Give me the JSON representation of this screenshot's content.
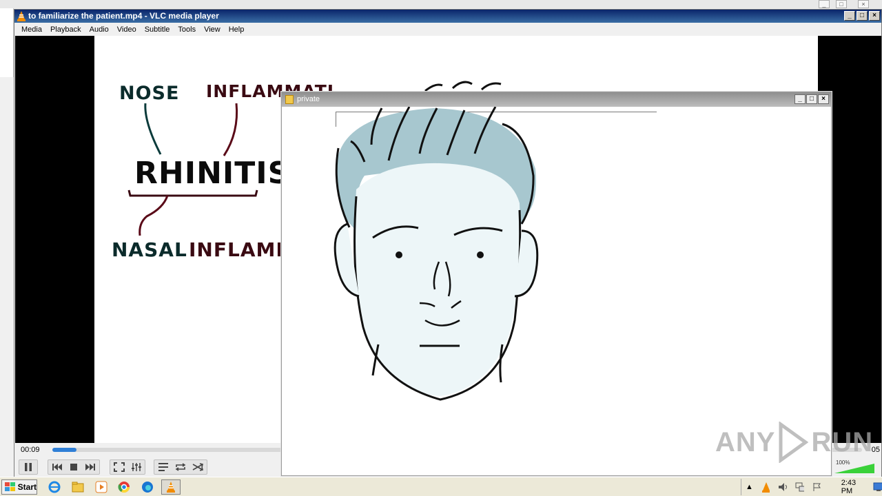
{
  "vlc": {
    "title": "to familiarize the patient.mp4 - VLC media player",
    "menu": [
      "Media",
      "Playback",
      "Audio",
      "Video",
      "Subtitle",
      "Tools",
      "View",
      "Help"
    ],
    "time_elapsed": "00:09",
    "time_total": "05",
    "progress": 0.03,
    "volume_label": "100%",
    "volume_level": 1.0
  },
  "video_content": {
    "word_nose": "NOSE",
    "word_inflammation_top": "INFLAMMATI...",
    "word_rhinitis": "RHINITIS",
    "word_nasal": "NASAL",
    "word_inflammation_bottom": "INFLAMMAT-"
  },
  "private_window": {
    "title": "private"
  },
  "watermark": {
    "text_left": "ANY",
    "text_right": "RUN"
  },
  "taskbar": {
    "start_label": "Start",
    "clock": "2:43 PM",
    "apps": [
      "internet-explorer-icon",
      "file-explorer-icon",
      "media-player-icon",
      "chrome-icon",
      "edge-icon",
      "vlc-icon"
    ]
  },
  "colors": {
    "accent_blue": "#2f7fd6",
    "title_blue": "#0a246a",
    "vlc_orange": "#f28c00"
  }
}
